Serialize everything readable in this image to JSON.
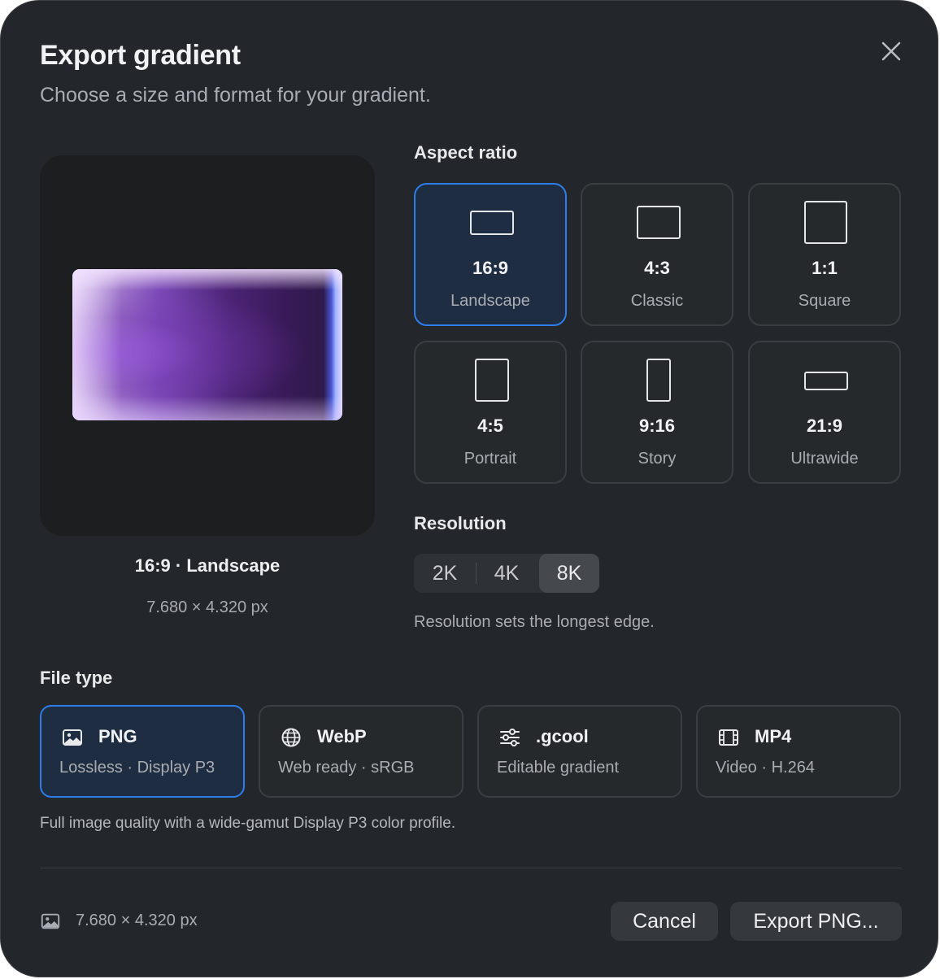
{
  "dialog": {
    "title": "Export gradient",
    "subtitle": "Choose a size and format for your gradient."
  },
  "preview": {
    "ratio_label": "16:9 · Landscape",
    "dimensions": "7.680 × 4.320 px"
  },
  "aspect": {
    "label": "Aspect ratio",
    "options": [
      {
        "ratio": "16:9",
        "name": "Landscape",
        "selected": true
      },
      {
        "ratio": "4:3",
        "name": "Classic",
        "selected": false
      },
      {
        "ratio": "1:1",
        "name": "Square",
        "selected": false
      },
      {
        "ratio": "4:5",
        "name": "Portrait",
        "selected": false
      },
      {
        "ratio": "9:16",
        "name": "Story",
        "selected": false
      },
      {
        "ratio": "21:9",
        "name": "Ultrawide",
        "selected": false
      }
    ]
  },
  "resolution": {
    "label": "Resolution",
    "options": [
      "2K",
      "4K",
      "8K"
    ],
    "selected": "8K",
    "help": "Resolution sets the longest edge."
  },
  "file_type": {
    "label": "File type",
    "options": [
      {
        "name": "PNG",
        "desc": "Lossless · Display P3",
        "icon": "image-icon",
        "selected": true
      },
      {
        "name": "WebP",
        "desc": "Web ready · sRGB",
        "icon": "globe-icon",
        "selected": false
      },
      {
        "name": ".gcool",
        "desc": "Editable gradient",
        "icon": "sliders-icon",
        "selected": false
      },
      {
        "name": "MP4",
        "desc": "Video · H.264",
        "icon": "film-icon",
        "selected": false
      }
    ],
    "help": "Full image quality with a wide-gamut Display P3 color profile."
  },
  "footer": {
    "dimensions": "7.680 × 4.320 px",
    "cancel_label": "Cancel",
    "export_label": "Export PNG..."
  },
  "colors": {
    "background": "#23262a",
    "accent": "#2f7de8",
    "selected_fill": "#1f2d42"
  }
}
